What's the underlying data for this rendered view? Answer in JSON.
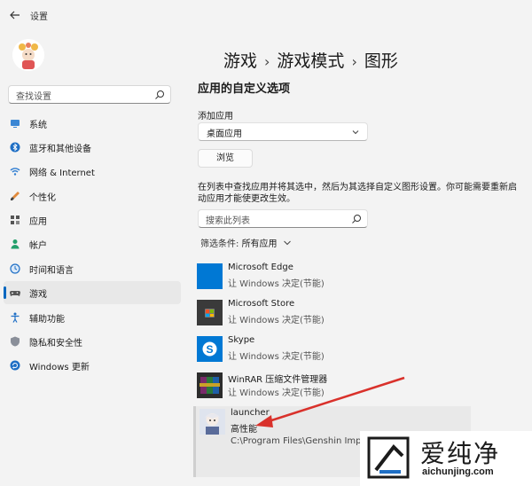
{
  "window": {
    "title": "设置"
  },
  "search": {
    "placeholder": "查找设置"
  },
  "sidebar": {
    "items": [
      {
        "label": "系统",
        "icon": "monitor-icon"
      },
      {
        "label": "蓝牙和其他设备",
        "icon": "bluetooth-icon"
      },
      {
        "label": "网络 & Internet",
        "icon": "wifi-icon"
      },
      {
        "label": "个性化",
        "icon": "brush-icon"
      },
      {
        "label": "应用",
        "icon": "apps-icon"
      },
      {
        "label": "帐户",
        "icon": "person-icon"
      },
      {
        "label": "时间和语言",
        "icon": "globe-clock-icon"
      },
      {
        "label": "游戏",
        "icon": "gamepad-icon"
      },
      {
        "label": "辅助功能",
        "icon": "accessibility-icon"
      },
      {
        "label": "隐私和安全性",
        "icon": "shield-icon"
      },
      {
        "label": "Windows 更新",
        "icon": "update-icon"
      }
    ],
    "active_index": 7
  },
  "breadcrumb": {
    "items": [
      "游戏",
      "游戏模式",
      "图形"
    ]
  },
  "main": {
    "section_title": "应用的自定义选项",
    "add_app_label": "添加应用",
    "dropdown_value": "桌面应用",
    "browse_label": "浏览",
    "description": "在列表中查找应用并将其选中，然后为其选择自定义图形设置。你可能需要重新启动应用才能使更改生效。",
    "app_search_placeholder": "搜索此列表",
    "filter_label": "筛选条件:",
    "filter_value": "所有应用"
  },
  "apps": [
    {
      "name": "Microsoft Edge",
      "setting": "让 Windows 决定(节能)",
      "icon": "edge-icon",
      "color": "#0078d4"
    },
    {
      "name": "Microsoft Store",
      "setting": "让 Windows 决定(节能)",
      "icon": "store-icon",
      "color": "#3a3a3a"
    },
    {
      "name": "Skype",
      "setting": "让 Windows 决定(节能)",
      "icon": "skype-icon",
      "color": "#0078d4"
    },
    {
      "name": "WinRAR 压缩文件管理器",
      "setting": "让 Windows 决定(节能)",
      "icon": "winrar-icon",
      "color": "#7a2a6a"
    },
    {
      "name": "launcher",
      "setting": "高性能",
      "path": "C:\\Program Files\\Genshin Impact\\",
      "icon": "launcher-icon",
      "selected": true
    }
  ],
  "watermark": {
    "text": "爱纯净",
    "url": "aichunjing.com"
  },
  "colors": {
    "accent": "#0067c0",
    "arrow": "#d9312b"
  }
}
